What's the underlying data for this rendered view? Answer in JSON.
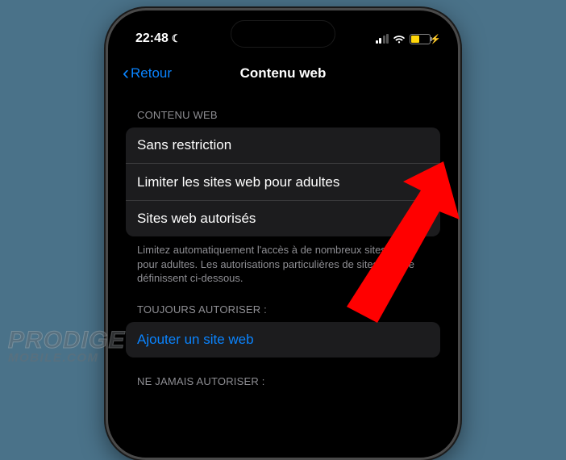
{
  "status": {
    "time": "22:48"
  },
  "nav": {
    "back": "Retour",
    "title": "Contenu web"
  },
  "section1": {
    "header": "CONTENU WEB",
    "rows": {
      "unrestricted": "Sans restriction",
      "limit_adult": "Limiter les sites web pour adultes",
      "allowed_only": "Sites web autorisés"
    },
    "footer": "Limitez automatiquement l'accès à de nombreux sites web pour adultes. Les autorisations particulières de sites web se définissent ci-dessous."
  },
  "section2": {
    "header": "TOUJOURS AUTORISER :",
    "add": "Ajouter un site web"
  },
  "section3": {
    "header": "NE JAMAIS AUTORISER :"
  },
  "watermark": {
    "line1": "PRODIGE",
    "line2": "MOBILE.COM"
  }
}
